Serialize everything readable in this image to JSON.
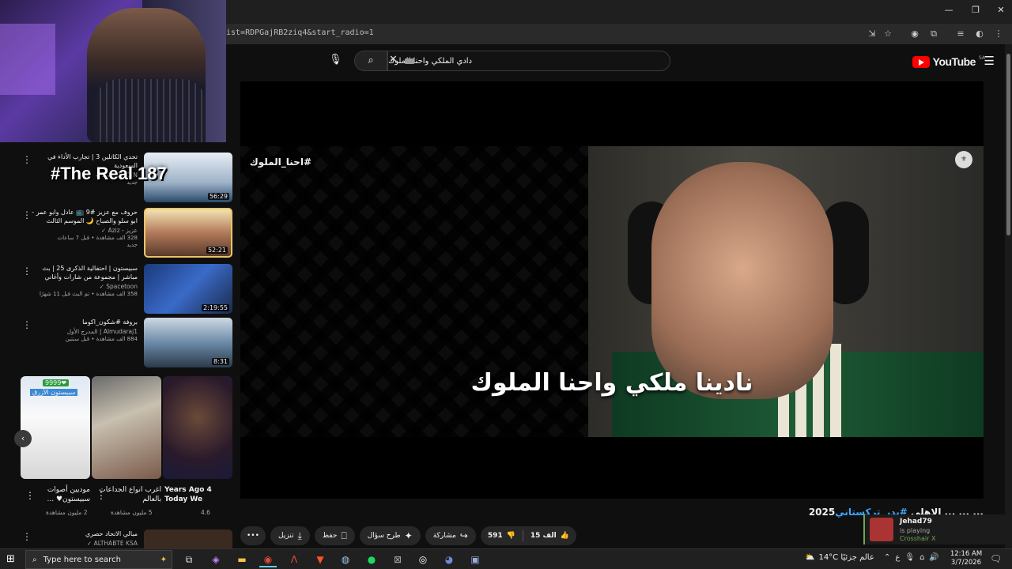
{
  "browser": {
    "url_fragment": "ist=RDPGajRB2ziq4&start_radio=1",
    "window_controls": [
      "—",
      "❐",
      "✕"
    ]
  },
  "youtube": {
    "logo_word": "YouTube",
    "logo_region": "SA",
    "search_value": "دادي الملكي واحنا الملوك"
  },
  "player": {
    "hashtag": "#احنا_الملوك",
    "subtitle": "نادينا ملكي واحنا الملوك"
  },
  "video": {
    "title_prefix": "... ... ... الاهلي ",
    "title_tag": "#بدر_تركستاني",
    "title_year": "2025",
    "actions": {
      "more": "•••",
      "download": "تنزيل",
      "save": "حفظ",
      "ask": "طرح سؤال",
      "share": "مشاركة",
      "dislikes": "591",
      "likes": "15 الف"
    }
  },
  "overlay_text": "#The Real 187",
  "sidebar": {
    "items": [
      {
        "title": "تحدي الكاتلين 3 | تجارب الأداء في السعودية",
        "channel": "LALFOUZAN ✓",
        "views": "مشاهدة",
        "badge": "جديد",
        "duration": "56:29"
      },
      {
        "title": "حروف مع عزيز #9 📺 عادل وابو عمر - ابو سلو والصباح 🌙 الموسم الثالث",
        "channel": "عزيز - Aziz ✓",
        "views": "328 الف مشاهدة • قبل 7 ساعات",
        "badge": "جديد",
        "duration": "52:21"
      },
      {
        "title": "سبيستون | احتفالية الذكرى 25 | بث مباشر | مجموعة من شارات وأغاني سبيستون",
        "channel": "Spacetoon ✓",
        "views": "358 الف مشاهدة • تم البث قبل 11 شهرًا",
        "badge": "",
        "duration": "2:19:55"
      },
      {
        "title": "بروفة #شكون_اكوما",
        "channel": "Almudaraj1 | المدرج الأول",
        "views": "884 الف مشاهدة • قبل سنتين",
        "badge": "",
        "duration": "8:31"
      }
    ],
    "shorts": [
      {
        "title": "Years Ago 4 Today We",
        "views": "4.6"
      },
      {
        "title": "اغرب انواع الجداعات بالعالم",
        "views": "5 مليون مشاهدة"
      },
      {
        "title": "موديين أصوات سبيستون♥ ...",
        "views": "2 مليون مشاهدة"
      }
    ],
    "short_badge": "9999❤",
    "short_label": "سبيستون الأزرق",
    "last_item": {
      "title": "مبالي الاتحاد حصري",
      "channel": "ALTHABTE KSA ✓"
    }
  },
  "notification": {
    "user": "Jehad79",
    "status": "is playing",
    "game": "Crosshair X"
  },
  "taskbar": {
    "search_placeholder": "Type here to search",
    "weather": "14°C  عالم جزئيًا",
    "lang": "ع",
    "time": "12:16 AM",
    "date": "3/7/2026"
  }
}
